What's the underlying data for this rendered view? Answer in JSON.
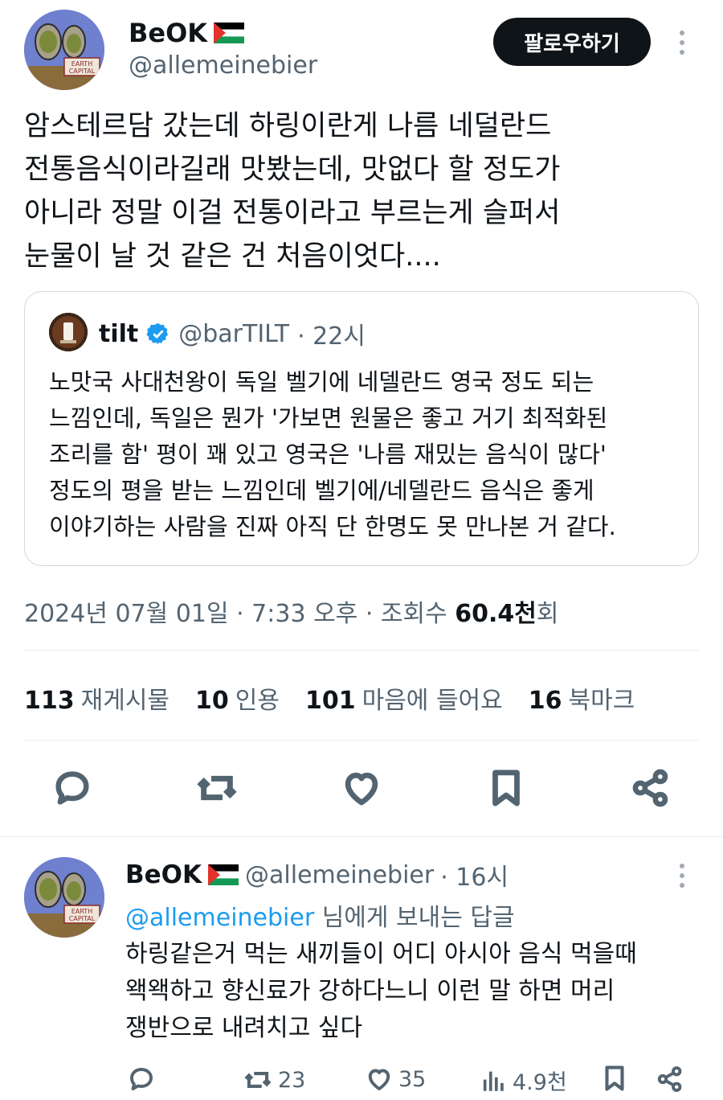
{
  "tweet": {
    "author_name": "BeOK",
    "author_handle": "@allemeinebier",
    "follow_label": "팔로우하기",
    "text": "암스테르담 갔는데 하링이란게 나름 네덜란드\n전통음식이라길래 맛봤는데, 맛없다 할 정도가\n아니라 정말 이걸 전통이라고 부르는게 슬퍼서\n눈물이 날 것 같은 건 처음이엇다....",
    "avatar_text": "EARTH CAPITAL",
    "quote": {
      "name": "tilt",
      "handle": "@barTILT",
      "time": "· 22시",
      "text": "노맛국 사대천왕이 독일 벨기에 네델란드 영국 정도 되는\n느낌인데, 독일은 뭔가 '가보면 원물은 좋고 거기 최적화된\n조리를 함' 평이 꽤 있고 영국은 '나름 재밌는 음식이 많다'\n정도의 평을 받는 느낌인데 벨기에/네델란드 음식은 좋게\n이야기하는 사람을 진짜 아직 단 한명도 못 만나본 거 같다."
    },
    "meta": {
      "date": "2024년 07월 01일 · 7:33 오후 · 조회수 ",
      "views": "60.4천",
      "views_suffix": "회"
    },
    "stats": [
      {
        "count": "113",
        "label": "재게시물"
      },
      {
        "count": "10",
        "label": "인용"
      },
      {
        "count": "101",
        "label": "마음에 들어요"
      },
      {
        "count": "16",
        "label": "북마크"
      }
    ]
  },
  "reply": {
    "author_name": "BeOK",
    "author_handle": "@allemeinebier",
    "time": "· 16시",
    "reply_to_handle": "@allemeinebier",
    "reply_to_suffix": " 님에게 보내는 답글",
    "text": "하링같은거 먹는 새끼들이 어디 아시아 음식 먹을때\n왝왝하고 향신료가 강하다느니 이런 말 하면 머리\n쟁반으로 내려치고 싶다",
    "retweets": "23",
    "likes": "35",
    "views": "4.9천"
  },
  "colors": {
    "accent": "#1d9bf0",
    "text": "#0f1419",
    "secondary": "#536471",
    "border": "#cfd9de"
  },
  "icons": [
    "reply-icon",
    "retweet-icon",
    "like-icon",
    "bookmark-icon",
    "share-icon",
    "views-icon",
    "verified-icon",
    "palestine-flag-icon",
    "more-icon"
  ]
}
